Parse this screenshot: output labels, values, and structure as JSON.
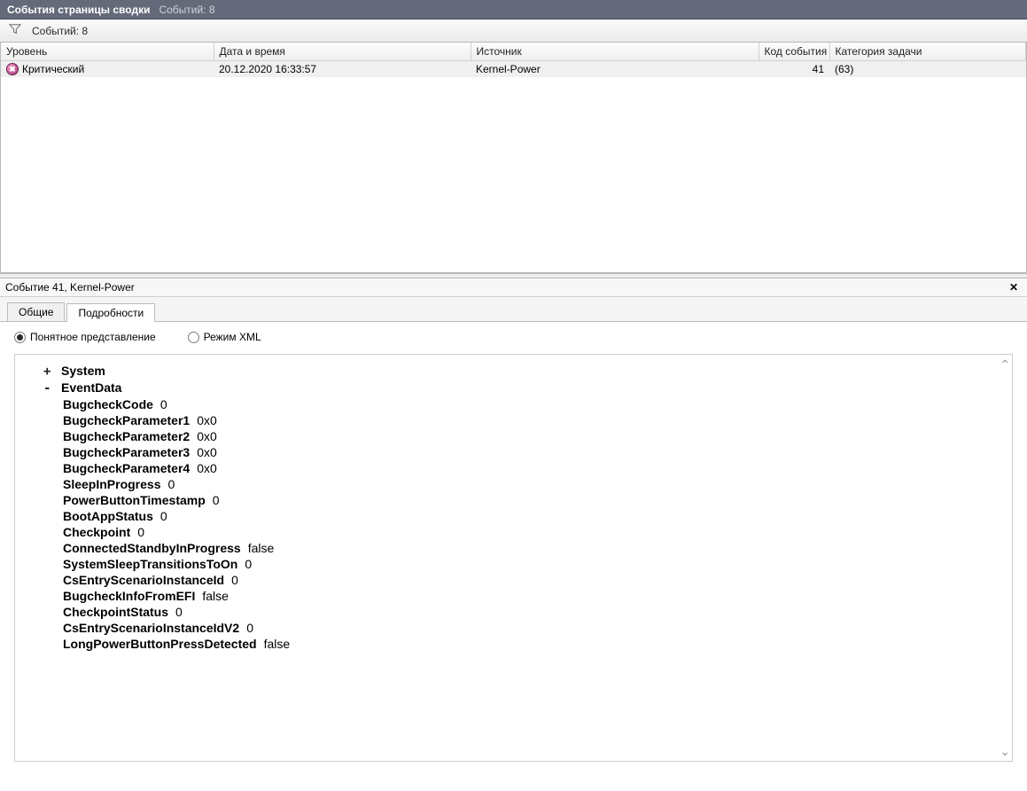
{
  "titlebar": {
    "title": "События страницы сводки",
    "count_label": "Событий: 8"
  },
  "filterbar": {
    "count_label": "Событий: 8"
  },
  "grid": {
    "cols": {
      "level": "Уровень",
      "datetime": "Дата и время",
      "source": "Источник",
      "eventid": "Код события",
      "taskcat": "Категория задачи"
    },
    "rows": [
      {
        "level": "Критический",
        "datetime": "20.12.2020 16:33:57",
        "source": "Kernel-Power",
        "eventid": "41",
        "taskcat": "(63)"
      }
    ]
  },
  "detail": {
    "header": "Событие 41, Kernel-Power",
    "tabs": {
      "general": "Общие",
      "details": "Подробности"
    },
    "radios": {
      "friendly": "Понятное представление",
      "xml": "Режим XML"
    },
    "tree": {
      "root1": "System",
      "root2": "EventData",
      "items": [
        {
          "k": "BugcheckCode",
          "v": "0"
        },
        {
          "k": "BugcheckParameter1",
          "v": "0x0"
        },
        {
          "k": "BugcheckParameter2",
          "v": "0x0"
        },
        {
          "k": "BugcheckParameter3",
          "v": "0x0"
        },
        {
          "k": "BugcheckParameter4",
          "v": "0x0"
        },
        {
          "k": "SleepInProgress",
          "v": "0"
        },
        {
          "k": "PowerButtonTimestamp",
          "v": "0"
        },
        {
          "k": "BootAppStatus",
          "v": "0"
        },
        {
          "k": "Checkpoint",
          "v": "0"
        },
        {
          "k": "ConnectedStandbyInProgress",
          "v": "false"
        },
        {
          "k": "SystemSleepTransitionsToOn",
          "v": "0"
        },
        {
          "k": "CsEntryScenarioInstanceId",
          "v": "0"
        },
        {
          "k": "BugcheckInfoFromEFI",
          "v": "false"
        },
        {
          "k": "CheckpointStatus",
          "v": "0"
        },
        {
          "k": "CsEntryScenarioInstanceIdV2",
          "v": "0"
        },
        {
          "k": "LongPowerButtonPressDetected",
          "v": "false"
        }
      ]
    }
  }
}
